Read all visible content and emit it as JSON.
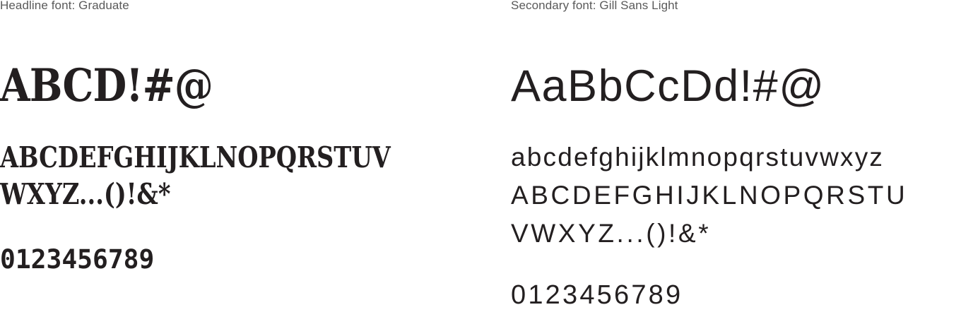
{
  "headline": {
    "caption": "Headline font: Graduate",
    "display": "ABCD!#@",
    "alphabet_line1": "ABCDEFGHIJKLNOPQRSTUV",
    "alphabet_line2": "WXYZ...()!&*",
    "numerals": "0123456789"
  },
  "secondary": {
    "caption": "Secondary font: Gill Sans Light",
    "display": "AaBbCcDd!#@",
    "lowercase": "abcdefghijklmnopqrstuvwxyz",
    "uppercase_line1": "ABCDEFGHIJKLNOPQRSTU",
    "uppercase_line2": "VWXYZ...()!&*",
    "numerals": "0123456789"
  }
}
